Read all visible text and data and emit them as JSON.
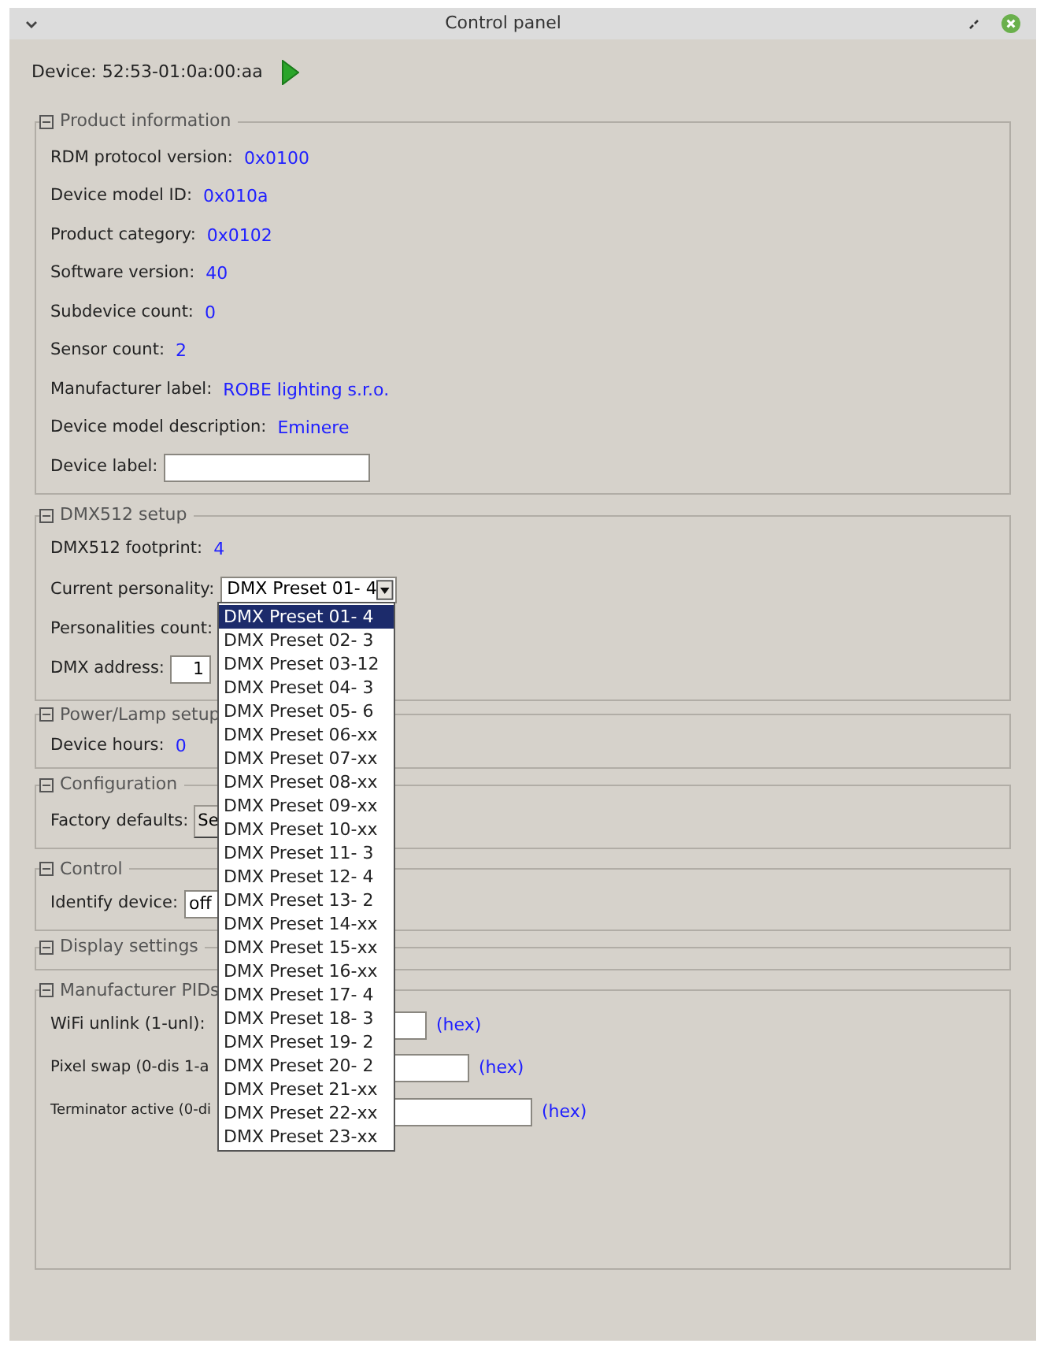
{
  "window": {
    "title": "Control panel"
  },
  "device": {
    "text": "Device: 52:53-01:0a:00:aa"
  },
  "sections": [
    {
      "title": "Product information",
      "expanded": true,
      "rows": [
        {
          "kind": "value",
          "label": "RDM protocol version:",
          "value": "0x0100"
        },
        {
          "kind": "value",
          "label": "Device model ID:",
          "value": "0x010a"
        },
        {
          "kind": "value",
          "label": "Product category:",
          "value": "0x0102"
        },
        {
          "kind": "value",
          "label": "Software version:",
          "value": "40"
        },
        {
          "kind": "value",
          "label": "Subdevice count:",
          "value": "0"
        },
        {
          "kind": "value",
          "label": "Sensor count:",
          "value": "2"
        },
        {
          "kind": "value",
          "label": "Manufacturer label:",
          "value": "ROBE lighting s.r.o."
        },
        {
          "kind": "value",
          "label": "Device model description:",
          "value": "Eminere"
        },
        {
          "kind": "input",
          "label": "Device label:"
        }
      ]
    },
    {
      "title": "DMX512 setup",
      "expanded": true,
      "rows": [
        {
          "kind": "value",
          "label": "DMX512 footprint:",
          "value": "4"
        },
        {
          "kind": "combo",
          "label": "Current personality:",
          "value": "DMX Preset 01- 4"
        },
        {
          "kind": "label",
          "label": "Personalities count:"
        },
        {
          "kind": "input",
          "label": "DMX address:",
          "value": "1"
        }
      ]
    },
    {
      "title": "Power/Lamp setup",
      "expanded": true,
      "rows": [
        {
          "kind": "value",
          "label": "Device hours:",
          "value": "0"
        }
      ]
    },
    {
      "title": "Configuration",
      "expanded": true,
      "rows": [
        {
          "kind": "button",
          "label": "Factory defaults:",
          "value": "Se"
        }
      ]
    },
    {
      "title": "Control",
      "expanded": true,
      "rows": [
        {
          "kind": "input",
          "label": "Identify device:",
          "value": "off"
        }
      ]
    },
    {
      "title": "Display settings",
      "expanded": true
    },
    {
      "title": "Manufacturer PIDs",
      "expanded": true,
      "rows": [
        {
          "kind": "input",
          "label": "WiFi unlink (1-unl):",
          "suffix": "(hex)"
        },
        {
          "kind": "input",
          "label": "Pixel swap (0-dis 1-a",
          "suffix": "(hex)"
        },
        {
          "kind": "input",
          "label": "Terminator active (0-di",
          "suffix": "(hex)"
        }
      ]
    }
  ],
  "dropdown": {
    "options": [
      {
        "label": "DMX Preset 01- 4",
        "selected": true
      },
      {
        "label": "DMX Preset 02- 3",
        "selected": false
      },
      {
        "label": "DMX Preset 03-12",
        "selected": false
      },
      {
        "label": "DMX Preset 04- 3",
        "selected": false
      },
      {
        "label": "DMX Preset 05- 6",
        "selected": false
      },
      {
        "label": "DMX Preset 06-xx",
        "selected": false
      },
      {
        "label": "DMX Preset 07-xx",
        "selected": false
      },
      {
        "label": "DMX Preset 08-xx",
        "selected": false
      },
      {
        "label": "DMX Preset 09-xx",
        "selected": false
      },
      {
        "label": "DMX Preset 10-xx",
        "selected": false
      },
      {
        "label": "DMX Preset 11- 3",
        "selected": false
      },
      {
        "label": "DMX Preset 12- 4",
        "selected": false
      },
      {
        "label": "DMX Preset 13- 2",
        "selected": false
      },
      {
        "label": "DMX Preset 14-xx",
        "selected": false
      },
      {
        "label": "DMX Preset 15-xx",
        "selected": false
      },
      {
        "label": "DMX Preset 16-xx",
        "selected": false
      },
      {
        "label": "DMX Preset 17- 4",
        "selected": false
      },
      {
        "label": "DMX Preset 18- 3",
        "selected": false
      },
      {
        "label": "DMX Preset 19- 2",
        "selected": false
      },
      {
        "label": "DMX Preset 20- 2",
        "selected": false
      },
      {
        "label": "DMX Preset 21-xx",
        "selected": false
      },
      {
        "label": "DMX Preset 22-xx",
        "selected": false
      },
      {
        "label": "DMX Preset 23-xx",
        "selected": false
      }
    ]
  }
}
